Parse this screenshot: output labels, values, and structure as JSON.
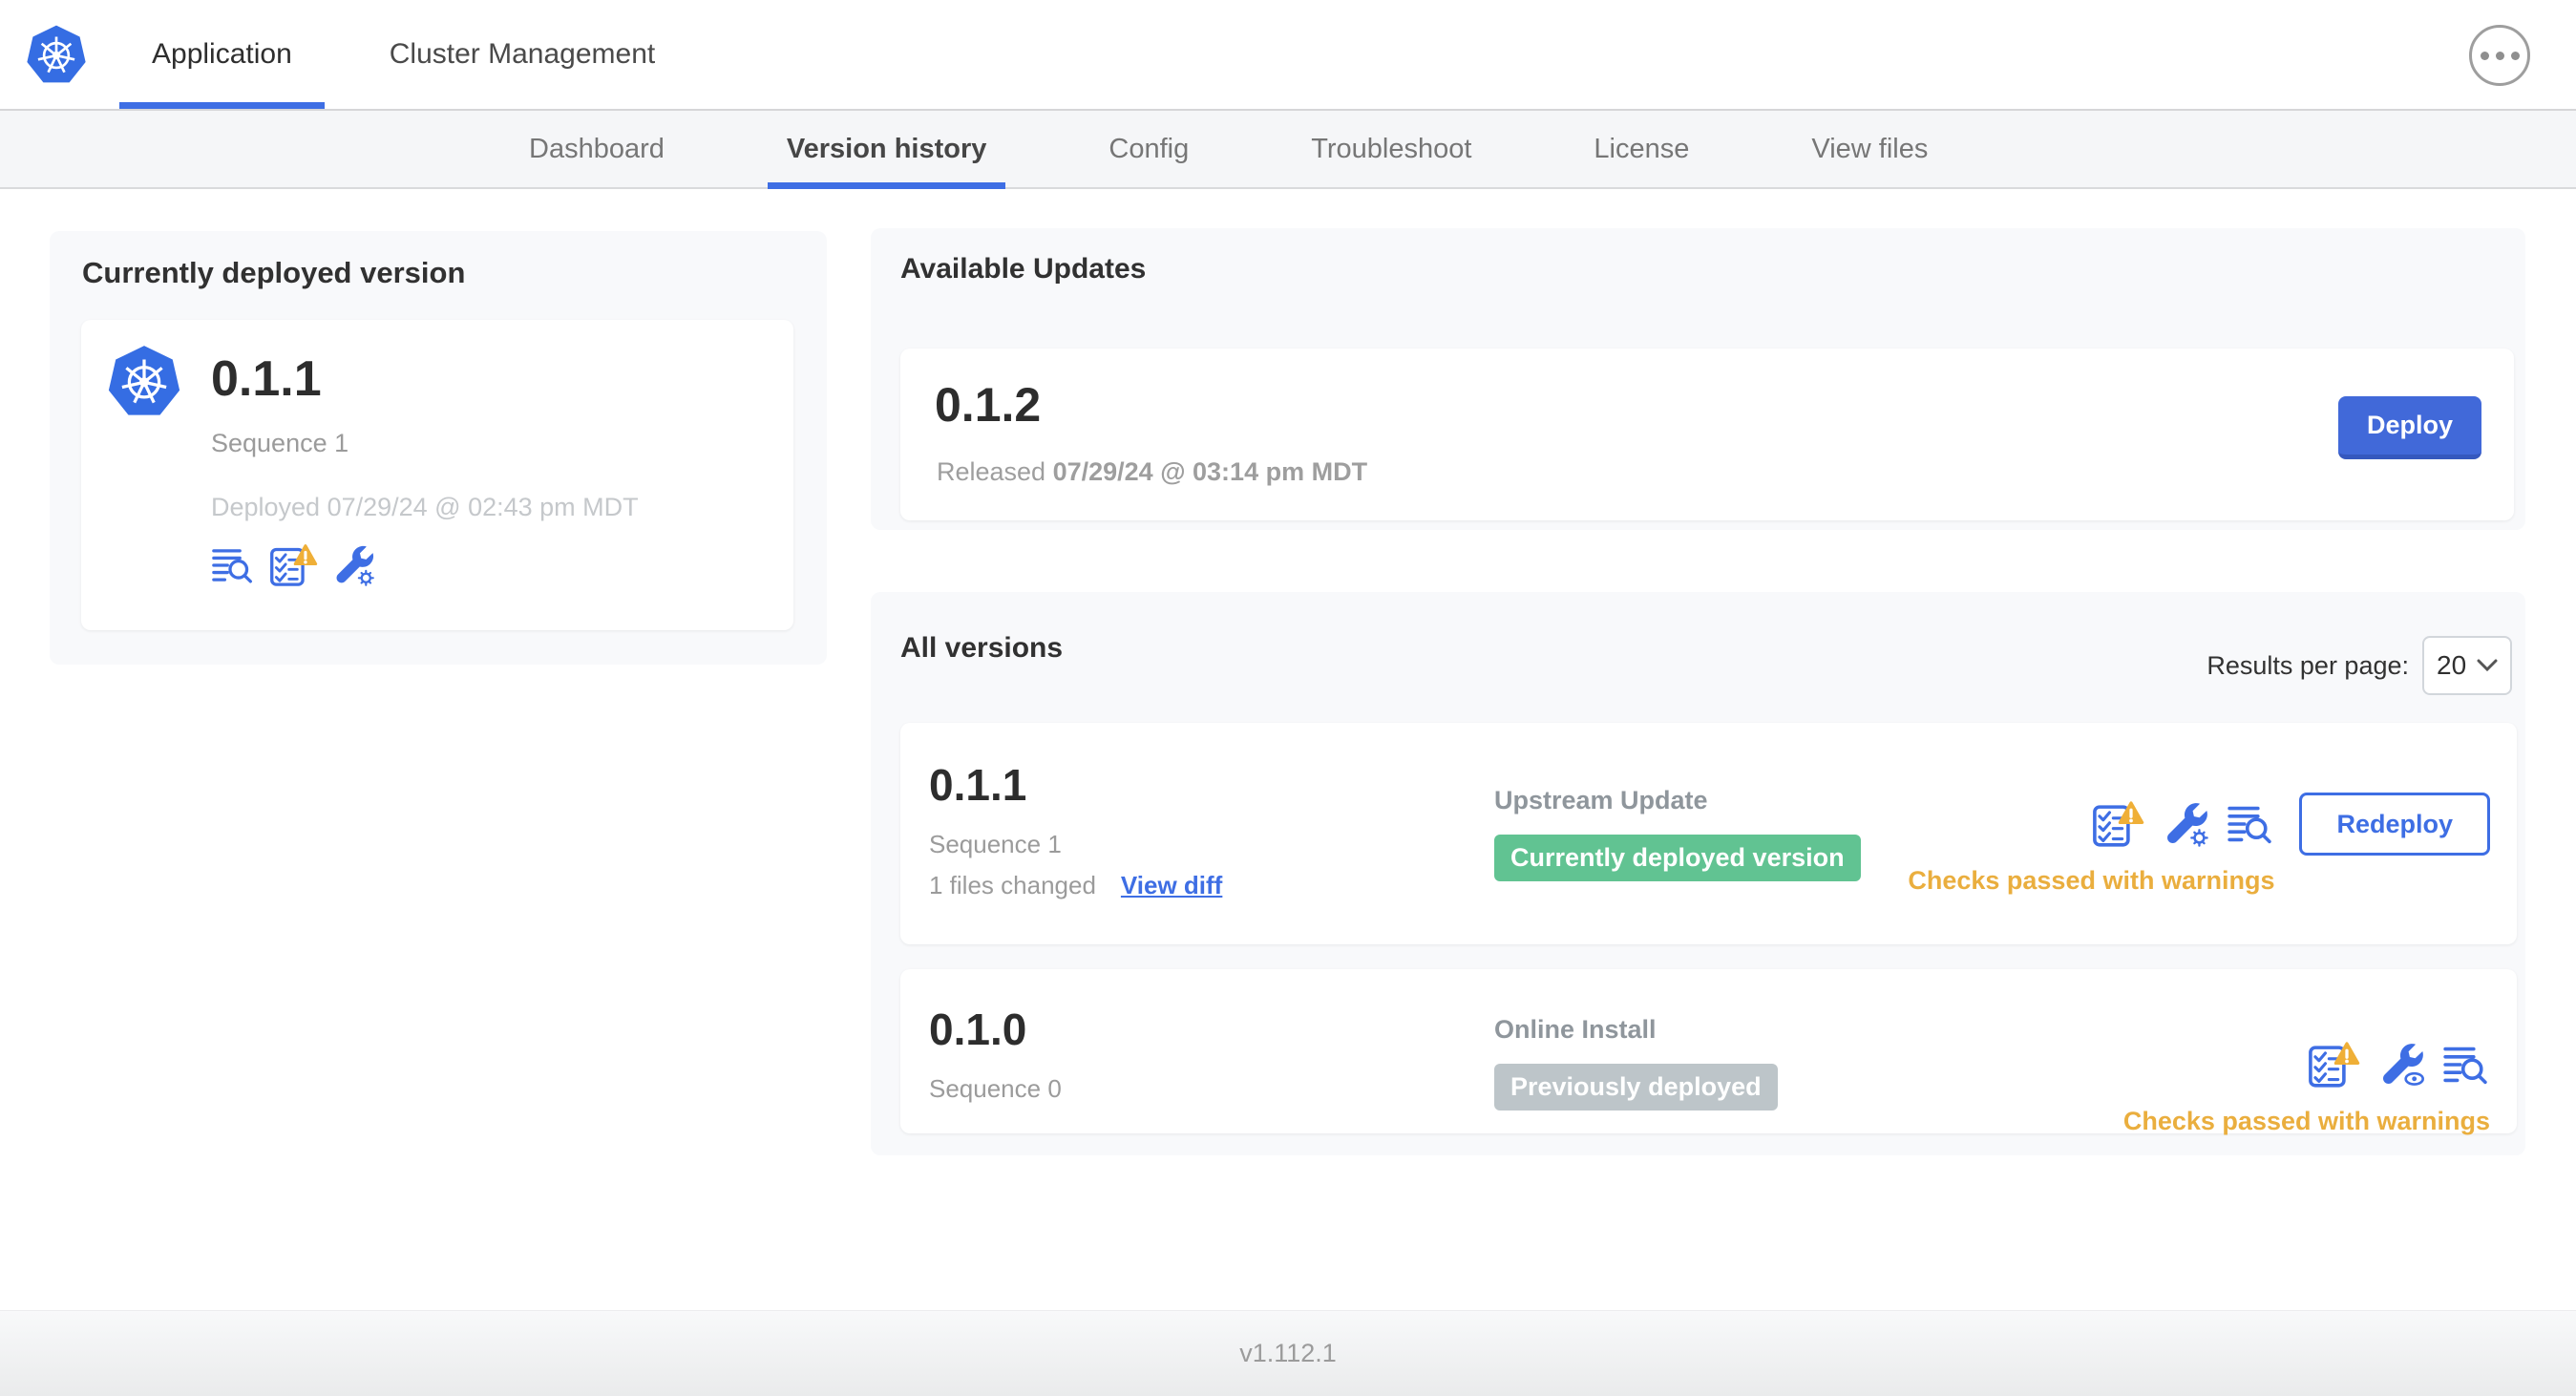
{
  "colors": {
    "accent_blue": "#3E6EE4",
    "deploy_button_blue": "#4169D9",
    "warning_orange": "#EAAE3E",
    "warning_triangle": "#EFAF37",
    "badge_green": "#61C392",
    "badge_gray": "#BDC5C9",
    "kubernetes_blue": "#356DE3",
    "card_background": "#F8F9FB",
    "subnav_background": "#F5F6F8"
  },
  "header": {
    "logo_icon": "kubernetes-logo",
    "more_menu_icon": "ellipsis-menu-icon",
    "tabs": [
      {
        "label": "Application",
        "active": true
      },
      {
        "label": "Cluster Management",
        "active": false
      }
    ]
  },
  "subnav": {
    "tabs": [
      {
        "label": "Dashboard",
        "active": false
      },
      {
        "label": "Version history",
        "active": true
      },
      {
        "label": "Config",
        "active": false
      },
      {
        "label": "Troubleshoot",
        "active": false
      },
      {
        "label": "License",
        "active": false
      },
      {
        "label": "View files",
        "active": false
      }
    ]
  },
  "currently_deployed": {
    "title": "Currently deployed version",
    "version": "0.1.1",
    "sequence": "Sequence 1",
    "deployed_timestamp": "Deployed 07/29/24 @ 02:43 pm MDT",
    "icons": [
      "release-notes-icon",
      "preflight-checks-warning-icon",
      "edit-config-icon"
    ]
  },
  "available_updates": {
    "title": "Available Updates",
    "update": {
      "version": "0.1.2",
      "released_prefix": "Released",
      "released_timestamp": "07/29/24 @ 03:14 pm MDT",
      "deploy_label": "Deploy"
    }
  },
  "all_versions": {
    "title": "All versions",
    "results_per_page_label": "Results per page:",
    "results_per_page_value": "20",
    "rows": [
      {
        "version": "0.1.1",
        "sequence": "Sequence 1",
        "files_changed": "1 files changed",
        "view_diff_label": "View diff",
        "source": "Upstream Update",
        "status_badge": "Currently deployed version",
        "badge_color": "#61C392",
        "checks_text": "Checks passed with warnings",
        "action_label": "Redeploy",
        "icons": [
          "preflight-checks-warning-icon",
          "edit-config-icon",
          "release-notes-icon"
        ]
      },
      {
        "version": "0.1.0",
        "sequence": "Sequence 0",
        "source": "Online Install",
        "status_badge": "Previously deployed",
        "badge_color": "#BDC5C9",
        "checks_text": "Checks passed with warnings",
        "icons": [
          "preflight-checks-warning-icon",
          "view-config-icon",
          "release-notes-icon"
        ]
      }
    ]
  },
  "footer": {
    "app_version": "v1.112.1"
  }
}
